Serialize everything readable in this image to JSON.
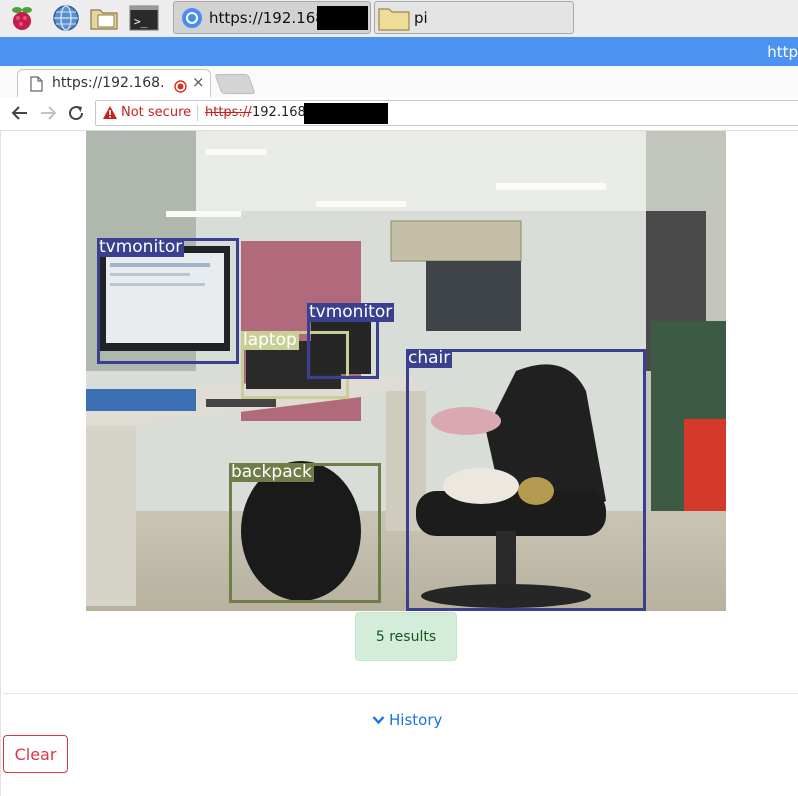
{
  "taskbar": {
    "launchers": [
      {
        "icon": "raspberry-menu-icon"
      },
      {
        "icon": "web-browser-icon"
      },
      {
        "icon": "file-manager-icon"
      },
      {
        "icon": "terminal-icon",
        "glyph": ">_"
      }
    ],
    "tasks": [
      {
        "label": "https://192.168.",
        "icon": "chromium-icon",
        "active": true
      },
      {
        "label": "pi",
        "icon": "folder-icon",
        "active": false
      }
    ]
  },
  "window": {
    "title": "http"
  },
  "tab": {
    "title": "https://192.168.",
    "close_glyph": "×"
  },
  "address_bar": {
    "security_label": "Not secure",
    "url_scheme": "https://",
    "url_host": "192.168."
  },
  "detections": [
    {
      "label": "tvmonitor",
      "color": "#3a3f8f"
    },
    {
      "label": "laptop",
      "color": "#c8cf96"
    },
    {
      "label": "tvmonitor",
      "color": "#3a3f8f"
    },
    {
      "label": "chair",
      "color": "#3a3f8f"
    },
    {
      "label": "backpack",
      "color": "#6f7e48"
    }
  ],
  "results": {
    "text": "5 results"
  },
  "history": {
    "label": "History"
  },
  "clear_button": {
    "label": "Clear"
  },
  "colors": {
    "titlebar": "#4c92f0",
    "danger": "#dc3545",
    "success_bg": "#d4edda",
    "link": "#1a73e8"
  }
}
